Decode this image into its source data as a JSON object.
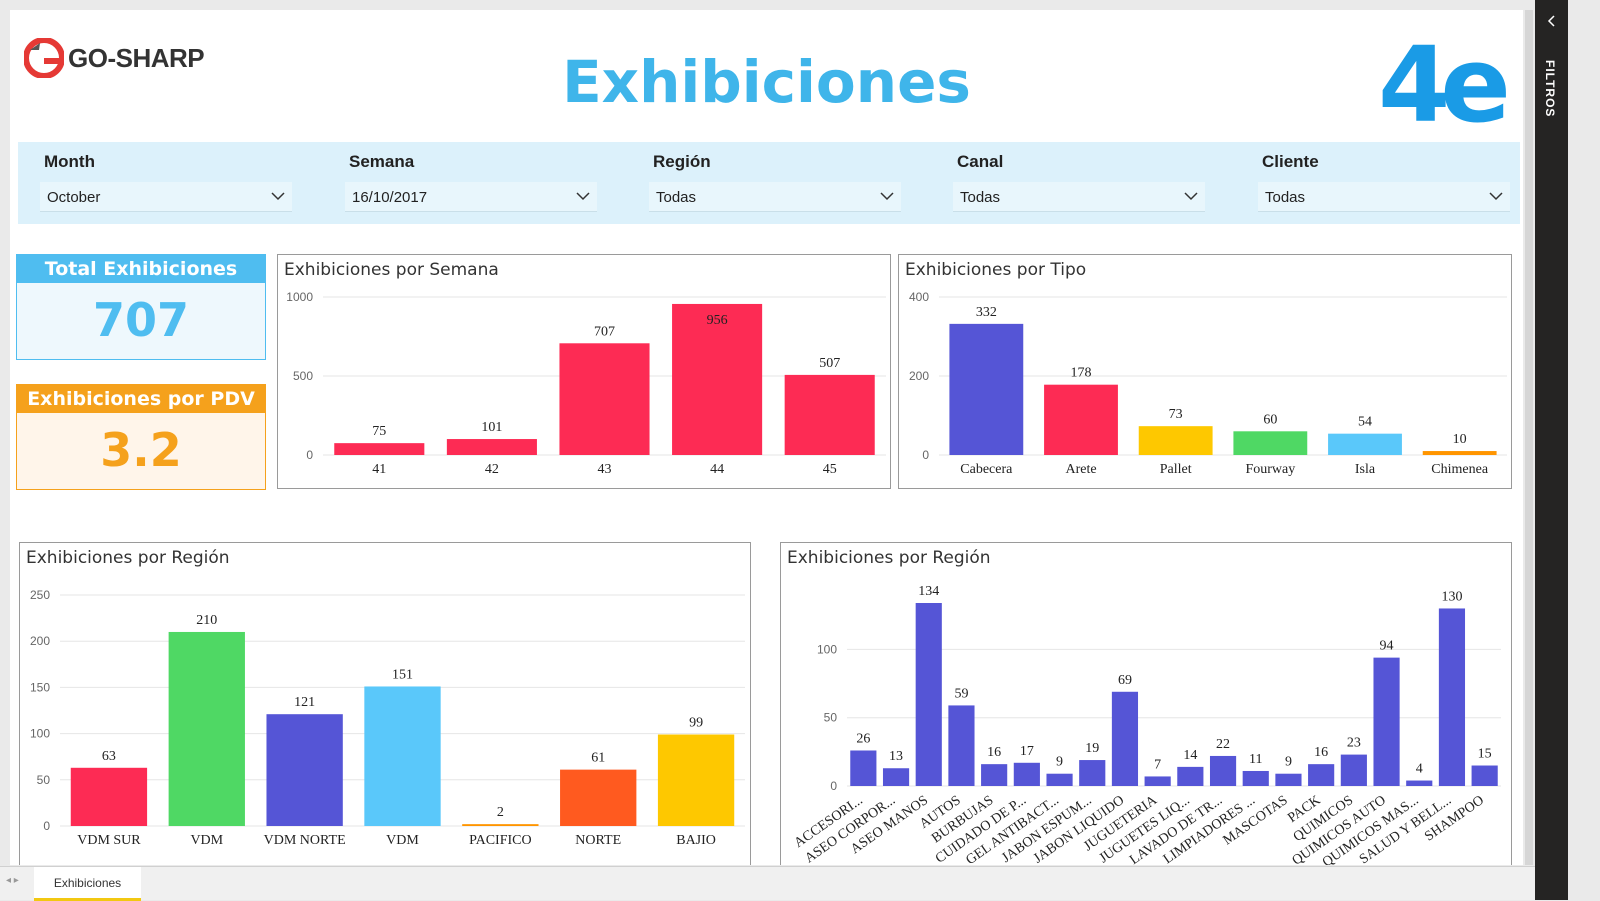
{
  "header": {
    "brand": "GO-SHARP",
    "title": "Exhibiciones",
    "right_logo_text": "4e"
  },
  "filters": [
    {
      "label": "Month",
      "value": "October"
    },
    {
      "label": "Semana",
      "value": "16/10/2017"
    },
    {
      "label": "Región",
      "value": "Todas"
    },
    {
      "label": "Canal",
      "value": "Todas"
    },
    {
      "label": "Cliente",
      "value": "Todas"
    }
  ],
  "kpis": {
    "total": {
      "label": "Total Exhibiciones",
      "value": "707",
      "color": "#4fbdf0"
    },
    "pdv": {
      "label": "Exhibiciones por PDV",
      "value": "3.2",
      "color": "#f5a11c"
    }
  },
  "side_panel": {
    "label": "FILTROS"
  },
  "pages": {
    "active": "Exhibiciones"
  },
  "chart_data": [
    {
      "id": "semana",
      "type": "bar",
      "title": "Exhibiciones por Semana",
      "categories": [
        "41",
        "42",
        "43",
        "44",
        "45"
      ],
      "values": [
        75,
        101,
        707,
        956,
        507
      ],
      "colors": [
        "#fd2b54",
        "#fd2b54",
        "#fd2b54",
        "#fd2b54",
        "#fd2b54"
      ],
      "ylim": [
        0,
        1000
      ],
      "yticks": [
        0,
        500,
        1000
      ],
      "grid": true
    },
    {
      "id": "tipo",
      "type": "bar",
      "title": "Exhibiciones por Tipo",
      "categories": [
        "Cabecera",
        "Arete",
        "Pallet",
        "Fourway",
        "Isla",
        "Chimenea"
      ],
      "values": [
        332,
        178,
        73,
        60,
        54,
        10
      ],
      "colors": [
        "#5555d6",
        "#fd2b54",
        "#fec800",
        "#4fd864",
        "#5ac8fa",
        "#ff9500"
      ],
      "ylim": [
        0,
        400
      ],
      "yticks": [
        0,
        200,
        400
      ],
      "grid": true
    },
    {
      "id": "region",
      "type": "bar",
      "title": "Exhibiciones por Región",
      "categories": [
        "VDM SUR",
        "VDM",
        "VDM NORTE",
        "VDM",
        "PACIFICO",
        "NORTE",
        "BAJIO"
      ],
      "values": [
        63,
        210,
        121,
        151,
        2,
        61,
        99
      ],
      "colors": [
        "#fd2b54",
        "#4fd864",
        "#5555d6",
        "#5ac8fa",
        "#ff9500",
        "#ff5a1f",
        "#fec800"
      ],
      "ylim": [
        0,
        250
      ],
      "yticks": [
        0,
        50,
        100,
        150,
        200,
        250
      ],
      "grid": true
    },
    {
      "id": "categoria",
      "type": "bar",
      "title": "Exhibiciones por Región",
      "categories": [
        "ACCESORI...",
        "ASEO CORPOR...",
        "ASEO MANOS",
        "AUTOS",
        "BURBUJAS",
        "CUIDADO DE P...",
        "GEL ANTIBACT...",
        "JABON ESPUM...",
        "JABON LIQUIDO",
        "JUGUETERIA",
        "JUGUETES LIQ...",
        "LAVADO DE TR...",
        "LIMPIADORES ...",
        "MASCOTAS",
        "PACK",
        "QUIMICOS",
        "QUIMICOS AUTO",
        "QUIMICOS MAS...",
        "SALUD Y BELL...",
        "SHAMPOO"
      ],
      "values": [
        26,
        13,
        134,
        59,
        16,
        17,
        9,
        19,
        69,
        7,
        14,
        22,
        11,
        9,
        16,
        23,
        94,
        4,
        130,
        15
      ],
      "color": "#5555d6",
      "ylim": [
        0,
        134
      ],
      "yticks": [
        0,
        50,
        100
      ],
      "grid": true
    }
  ]
}
